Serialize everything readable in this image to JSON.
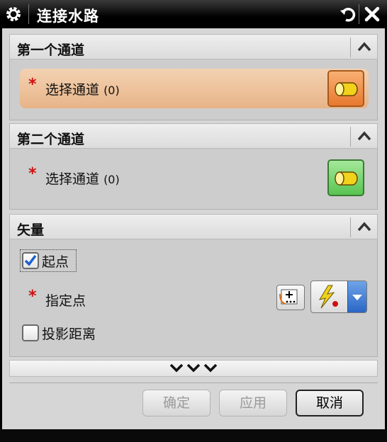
{
  "window": {
    "title": "连接水路",
    "icons": {
      "settings": "gear-icon",
      "reset": "reset-icon",
      "close": "close-icon"
    }
  },
  "groups": [
    {
      "title": "第一个通道",
      "select_label": "选择通道",
      "select_count": "(0)",
      "required": "*",
      "icon": "cylinder-icon",
      "state": "active"
    },
    {
      "title": "第二个通道",
      "select_label": "选择通道",
      "select_count": "(0)",
      "required": "*",
      "icon": "cylinder-icon",
      "state": "inactive"
    },
    {
      "title": "矢量",
      "start_point_label": "起点",
      "start_point_checked": true,
      "specify_point_label": "指定点",
      "required": "*",
      "projection_label": "投影距离",
      "projection_checked": false,
      "icons": {
        "point_dialog": "point-dialog-icon",
        "inferred_point": "inferred-point-icon",
        "dropdown": "chevron-down-icon"
      }
    }
  ],
  "more_options_icon": "triple-chevron-down-icon",
  "footer": {
    "ok_label": "确定",
    "apply_label": "应用",
    "cancel_label": "取消"
  },
  "colors": {
    "required": "#d01010",
    "active_row": "#e8b488",
    "checkbox_check": "#1a5fd0"
  }
}
